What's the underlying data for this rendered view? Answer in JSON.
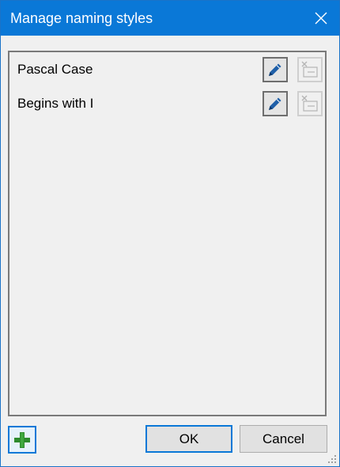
{
  "dialog": {
    "title": "Manage naming styles",
    "close_icon": "close-icon"
  },
  "list": {
    "items": [
      {
        "label": "Pascal Case",
        "edit_icon": "pencil-icon",
        "remove_icon": "remove-item-icon",
        "remove_enabled": false
      },
      {
        "label": "Begins with I",
        "edit_icon": "pencil-icon",
        "remove_icon": "remove-item-icon",
        "remove_enabled": false
      }
    ]
  },
  "footer": {
    "add_icon": "plus-icon",
    "ok_label": "OK",
    "cancel_label": "Cancel"
  },
  "colors": {
    "titlebar": "#0a78d7",
    "focus_border": "#0a78d7",
    "pencil": "#1f5fa8",
    "plus": "#2e8b2e"
  }
}
